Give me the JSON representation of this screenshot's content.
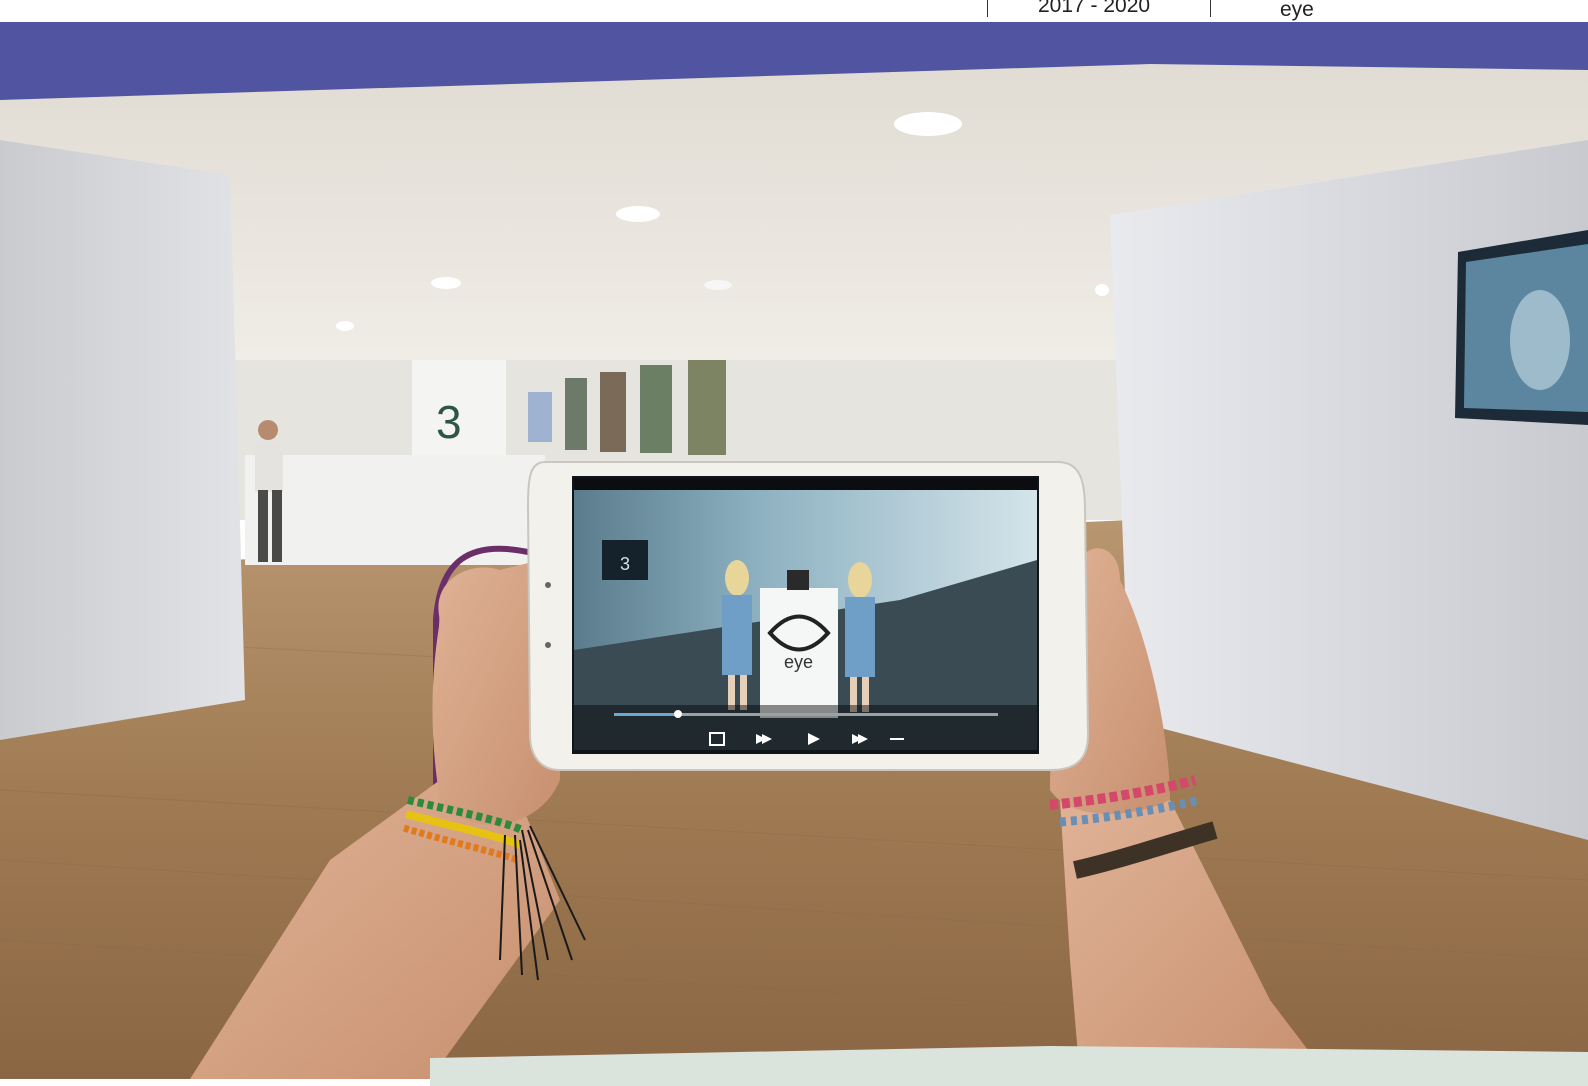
{
  "header": {
    "years": "2017 - 2020",
    "brand": "eye"
  },
  "photo": {
    "screen_logo_text": "eye",
    "wall_sign": "3rd"
  },
  "colors": {
    "band": "#5154a1",
    "panel": "#dbe4dc",
    "floor": "#a27d55",
    "wall": "#e8e8ea"
  }
}
